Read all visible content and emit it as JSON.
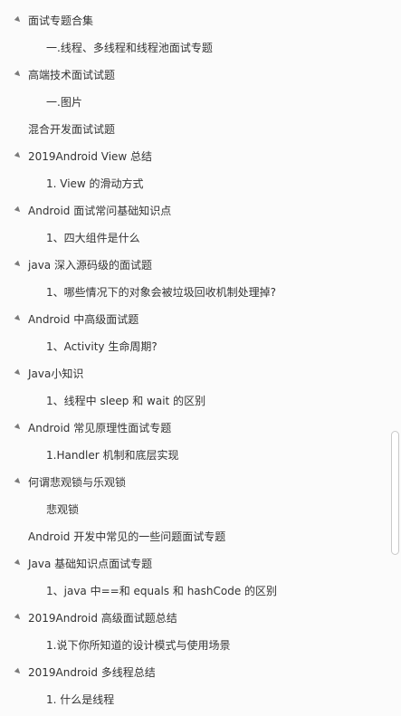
{
  "outline": [
    {
      "level": 1,
      "expanded": true,
      "label": "面试专题合集"
    },
    {
      "level": 2,
      "label": "一.线程、多线程和线程池面试专题"
    },
    {
      "level": 1,
      "expanded": true,
      "label": "高端技术面试试题"
    },
    {
      "level": 2,
      "label": "一.图片"
    },
    {
      "level": 1,
      "expanded": false,
      "label": "混合开发面试试题"
    },
    {
      "level": 1,
      "expanded": true,
      "label": "2019Android View 总结"
    },
    {
      "level": 2,
      "label": "1. View 的滑动方式"
    },
    {
      "level": 1,
      "expanded": true,
      "label": "Android 面试常问基础知识点"
    },
    {
      "level": 2,
      "label": "1、四大组件是什么"
    },
    {
      "level": 1,
      "expanded": true,
      "label": "java 深入源码级的面试题"
    },
    {
      "level": 2,
      "label": "1、哪些情况下的对象会被垃圾回收机制处理掉?"
    },
    {
      "level": 1,
      "expanded": true,
      "label": "Android 中高级面试题"
    },
    {
      "level": 2,
      "label": "1、Activity 生命周期?"
    },
    {
      "level": 1,
      "expanded": true,
      "label": "Java小知识"
    },
    {
      "level": 2,
      "label": "1、线程中 sleep 和 wait 的区别"
    },
    {
      "level": 1,
      "expanded": true,
      "label": "Android 常见原理性面试专题"
    },
    {
      "level": 2,
      "label": "1.Handler 机制和底层实现"
    },
    {
      "level": 1,
      "expanded": true,
      "label": "何谓悲观锁与乐观锁"
    },
    {
      "level": 2,
      "label": "悲观锁"
    },
    {
      "level": 1,
      "expanded": false,
      "label": "Android 开发中常见的一些问题面试专题"
    },
    {
      "level": 1,
      "expanded": true,
      "label": "Java 基础知识点面试专题"
    },
    {
      "level": 2,
      "label": "1、java 中==和 equals 和 hashCode 的区别"
    },
    {
      "level": 1,
      "expanded": true,
      "label": "2019Android 高级面试题总结"
    },
    {
      "level": 2,
      "label": "1.说下你所知道的设计模式与使用场景"
    },
    {
      "level": 1,
      "expanded": true,
      "label": "2019Android 多线程总结"
    },
    {
      "level": 2,
      "label": "1. 什么是线程"
    }
  ],
  "icons": {
    "expanded": "triangle-down-right-icon"
  }
}
